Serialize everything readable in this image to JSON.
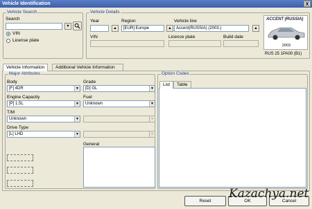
{
  "window": {
    "title": "Vehicle Identification",
    "close_glyph": "X"
  },
  "vehicle_search": {
    "legend": "Vehicle Search",
    "search_label": "Search",
    "search_value": "",
    "radio_vin": "VIN",
    "radio_license": "License plate",
    "selected": "VIN"
  },
  "vehicle_details": {
    "legend": "Vehicle Details",
    "year_label": "Year",
    "year_value": "",
    "region_label": "Region",
    "region_value": "[EUR]  Europe",
    "vehicle_line_label": "Vehicle line",
    "vehicle_line_value": "Accent(RUSSIA) (2003.)",
    "vin_label": "VIN",
    "vin_value": "",
    "licence_label": "Licence plate",
    "licence_value": "",
    "build_date_label": "Build date",
    "build_date_value": "",
    "car_name": "ACCENT (RUSSIA)",
    "car_year": "2003",
    "code": "RUS 25 1PA00 (B1)"
  },
  "tabs": [
    {
      "label": "Vehicle Information",
      "active": true
    },
    {
      "label": "Additional Vehicle Information",
      "active": false
    }
  ],
  "major": {
    "legend": "Major Attributes",
    "body_label": "Body",
    "body_value": "[F] 4DR",
    "grade_label": "Grade",
    "grade_value": "[D] GL",
    "engine_label": "Engine Capacity",
    "engine_value": "[P] 1.5L",
    "fuel_label": "Fuel",
    "fuel_value": "Unknown",
    "tm_label": "T/M",
    "tm_value": "Unknown",
    "drive_label": "Drive Type",
    "drive_value": "[L] LHD",
    "general_label": "General"
  },
  "options": {
    "legend": "Option Codes",
    "tabs": [
      "List",
      "Table"
    ]
  },
  "buttons": {
    "reset": "Reset",
    "ok": "OK",
    "cancel": "Cancel"
  },
  "watermark": "Kazachya.net"
}
